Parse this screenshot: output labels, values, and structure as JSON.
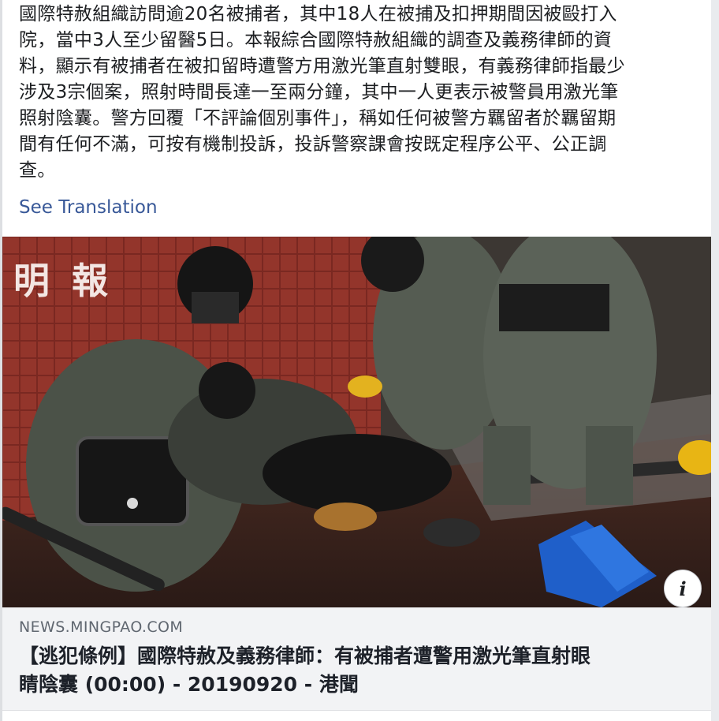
{
  "post": {
    "text_lines": [
      "國際特赦組織訪問逾20名被捕者，其中18人在被捕及扣押期間因被毆打入",
      "院，當中3人至少留醫5日。本報綜合國際特赦組織的調查及義務律師的資",
      "料，顯示有被捕者在被扣留時遭警方用激光筆直射雙眼，有義務律師指最少",
      "涉及3宗個案，照射時間長達一至兩分鐘，其中一人更表示被警員用激光筆",
      "照射陰囊。警方回覆「不評論個別事件」，稱如任何被警方羈留者於羈留期",
      "間有任何不滿，可按有機制投訴，投訴警察課會按既定程序公平、公正調",
      "查。"
    ],
    "see_translation": "See Translation"
  },
  "photo": {
    "watermark": "明 報",
    "info_icon": "i"
  },
  "link_preview": {
    "domain": "NEWS.MINGPAO.COM",
    "title_lines": [
      "【逃犯條例】國際特赦及義務律師：有被捕者遭警用激光筆直射眼",
      "睛陰囊 (00:00) - 20190920 - 港聞"
    ]
  },
  "colors": {
    "link_blue": "#385898",
    "text_dark": "#1c1e21",
    "preview_bg": "#f2f3f5",
    "muted_gray": "#606770"
  }
}
